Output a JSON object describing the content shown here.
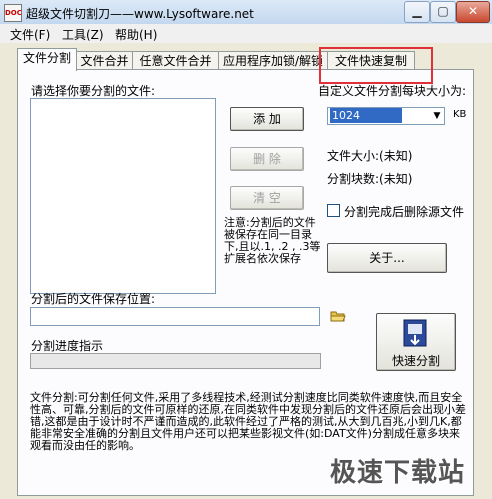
{
  "window": {
    "title": "超级文件切割刀——www.Lysoftware.net",
    "icon_text": "DOC",
    "minimize_glyph": "▁",
    "maximize_glyph": "▢",
    "close_glyph": "✕"
  },
  "menu": {
    "file": "文件(F)",
    "tools": "工具(Z)",
    "help": "帮助(H)"
  },
  "tabs": [
    {
      "label": "文件分割",
      "active": true
    },
    {
      "label": "文件合并",
      "active": false
    },
    {
      "label": "任意文件合并",
      "active": false
    },
    {
      "label": "应用程序加锁/解锁",
      "active": false
    },
    {
      "label": "文件快速复制",
      "active": false
    }
  ],
  "split": {
    "select_label": "请选择你要分割的文件:",
    "add_button": "添  加",
    "delete_button": "删  除",
    "clear_button": "清  空",
    "chunk_label": "自定义文件分割每块大小为:",
    "chunk_value": "1024",
    "chunk_unit": "KB",
    "file_size": "文件大小:(未知)",
    "chunk_count": "分割块数:(未知)",
    "delete_source_label": "分割完成后删除源文件",
    "delete_source_checked": false,
    "note": "注意:分割后的文件被保存在同一目录下,且以.1, .2 , .3等扩展名依次保存",
    "about_button": "关于...",
    "save_location_label": "分割后的文件保存位置:",
    "save_location_value": "",
    "progress_label": "分割进度指示",
    "progress_value": 0,
    "quick_split_button": "快速分割",
    "description": "文件分割:可分割任何文件,采用了多线程技术,经测试分割速度比同类软件速度快,而且安全性高、可靠,分割后的文件可原样的还原,在同类软件中发现分割后的文件还原后会出现小差错,这都是由于设计时不严谨而造成的,此软件经过了严格的测试,从大到几百兆,小到几K,都能非常安全准确的分割且文件用户还可以把某些影视文件(如:DAT文件)分割成任意多块来观看而没由任的影响。"
  },
  "watermark": "极速下载站",
  "colors": {
    "highlight_box": "#e0303a",
    "selection": "#316ac5"
  }
}
